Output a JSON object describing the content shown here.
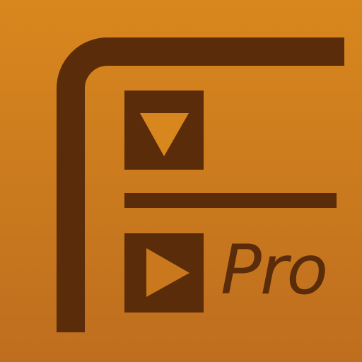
{
  "app_icon": {
    "label": "Pro",
    "colors": {
      "background_top": "#D8871E",
      "background_bottom": "#BE6E1E",
      "foreground": "#5A2C0A"
    },
    "icons": [
      "down-arrow-icon",
      "right-arrow-icon"
    ]
  }
}
